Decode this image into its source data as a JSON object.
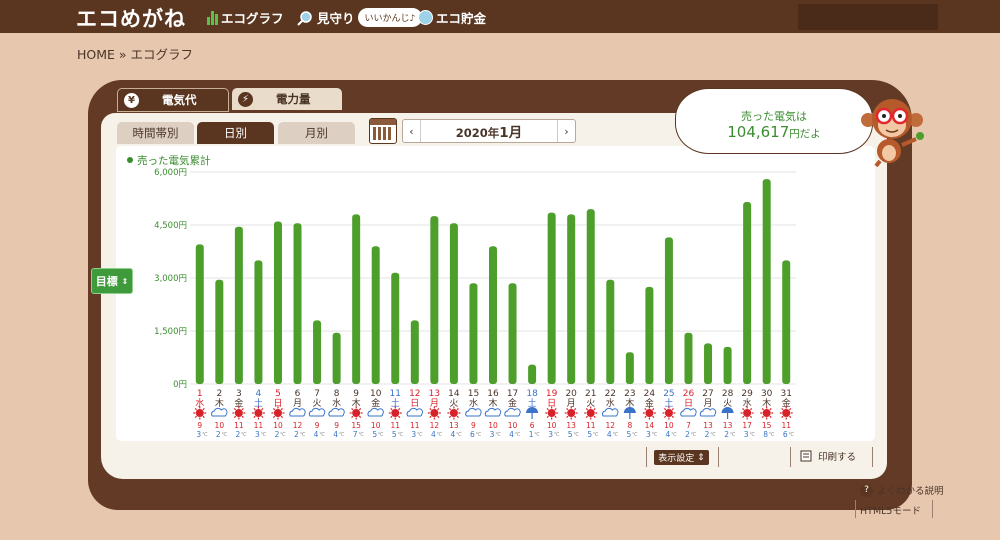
{
  "header": {
    "logo": "エコめがね",
    "nav": [
      {
        "label": "エコグラフ",
        "icon": "bar-chart-icon"
      },
      {
        "label": "見守り",
        "icon": "magnifier-icon",
        "bubble": "いいかんじ♪"
      },
      {
        "label": "エコ貯金",
        "icon": "coin-icon"
      }
    ]
  },
  "breadcrumb": "HOME » エコグラフ",
  "tabs": {
    "electricity_cost": "電気代",
    "electricity_amount": "電力量",
    "yen_symbol": "¥"
  },
  "subtabs": {
    "hourly": "時間帯別",
    "daily": "日別",
    "monthly": "月別"
  },
  "month_selector": {
    "prefix": "2020年",
    "month": "1月",
    "prev": "‹",
    "next": "›"
  },
  "target_toggle": "目標",
  "sold_bubble": {
    "line1": "売った電気は",
    "amount": "104,617",
    "suffix": "円だよ"
  },
  "footer": {
    "display_settings": "表示設定",
    "print": "印刷する",
    "help": "よくわかる説明",
    "html5": "HTML5モード"
  },
  "colors": {
    "bar": "#4e9e2c",
    "brown": "#5a3620",
    "saturday": "#3a73c9",
    "sunday": "#d8222a",
    "weekday": "#4a3428",
    "accent_green": "#3a8e2f"
  },
  "weather_icons": [
    "sun-icon",
    "cloud-icon",
    "umbrella-icon"
  ],
  "chart_data": {
    "type": "bar",
    "legend": "売った電気累計",
    "ylim": [
      0,
      6000
    ],
    "y_ticks": [
      "0円",
      "1,500円",
      "3,000円",
      "4,500円",
      "6,000円"
    ],
    "days": [
      "1",
      "2",
      "3",
      "4",
      "5",
      "6",
      "7",
      "8",
      "9",
      "10",
      "11",
      "12",
      "13",
      "14",
      "15",
      "16",
      "17",
      "18",
      "19",
      "20",
      "21",
      "22",
      "23",
      "24",
      "25",
      "26",
      "27",
      "28",
      "29",
      "30",
      "31"
    ],
    "weekdays": [
      "水",
      "木",
      "金",
      "土",
      "日",
      "月",
      "火",
      "水",
      "木",
      "金",
      "土",
      "日",
      "月",
      "火",
      "水",
      "木",
      "金",
      "土",
      "日",
      "月",
      "火",
      "水",
      "木",
      "金",
      "土",
      "日",
      "月",
      "火",
      "水",
      "木",
      "金"
    ],
    "day_colors": [
      "sunday",
      "weekday",
      "weekday",
      "saturday",
      "sunday",
      "weekday",
      "weekday",
      "weekday",
      "weekday",
      "weekday",
      "saturday",
      "sunday",
      "sunday",
      "weekday",
      "weekday",
      "weekday",
      "weekday",
      "saturday",
      "sunday",
      "weekday",
      "weekday",
      "weekday",
      "weekday",
      "weekday",
      "saturday",
      "sunday",
      "weekday",
      "weekday",
      "weekday",
      "weekday",
      "weekday"
    ],
    "values": [
      3950,
      2950,
      4450,
      3500,
      4600,
      4550,
      1800,
      1450,
      4800,
      3900,
      3150,
      1800,
      4750,
      4550,
      2850,
      3900,
      2850,
      550,
      4850,
      4800,
      4950,
      2950,
      900,
      2750,
      4150,
      1450,
      1150,
      1050,
      5150,
      5800,
      3500
    ],
    "weather": [
      "sun-icon",
      "cloud-icon",
      "sun-icon",
      "sun-icon",
      "sun-icon",
      "cloud-icon",
      "cloud-icon",
      "cloud-icon",
      "sun-icon",
      "cloud-icon",
      "sun-icon",
      "cloud-icon",
      "sun-icon",
      "sun-icon",
      "cloud-icon",
      "cloud-icon",
      "cloud-icon",
      "umbrella-icon",
      "sun-icon",
      "sun-icon",
      "sun-icon",
      "cloud-icon",
      "umbrella-icon",
      "sun-icon",
      "sun-icon",
      "cloud-icon",
      "cloud-icon",
      "umbrella-icon",
      "sun-icon",
      "sun-icon",
      "sun-icon"
    ],
    "temp_high": [
      9,
      10,
      11,
      11,
      10,
      12,
      9,
      9,
      15,
      10,
      11,
      11,
      12,
      13,
      9,
      10,
      10,
      6,
      10,
      13,
      11,
      12,
      8,
      14,
      10,
      7,
      13,
      13,
      17,
      15,
      11
    ],
    "temp_low": [
      3,
      2,
      2,
      3,
      2,
      2,
      4,
      4,
      7,
      5,
      5,
      3,
      4,
      4,
      6,
      3,
      4,
      1,
      3,
      5,
      5,
      4,
      5,
      3,
      4,
      2,
      2,
      2,
      3,
      8,
      6
    ],
    "temp_unit": "℃"
  }
}
